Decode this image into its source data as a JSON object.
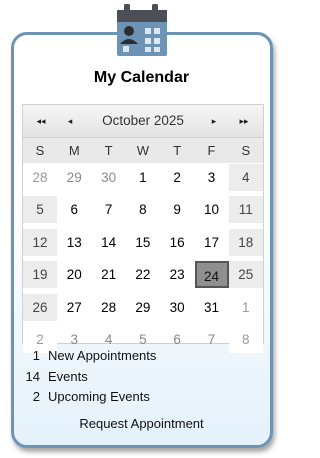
{
  "widget": {
    "title": "My Calendar",
    "request_label": "Request Appointment"
  },
  "calendar": {
    "month_label": "October 2025",
    "nav": {
      "prev_year": "◂◂",
      "prev_month": "◂",
      "next_month": "▸",
      "next_year": "▸▸"
    },
    "weekdays": [
      "S",
      "M",
      "T",
      "W",
      "T",
      "F",
      "S"
    ],
    "weeks": [
      [
        "28",
        "29",
        "30",
        "1",
        "2",
        "3",
        "4"
      ],
      [
        "5",
        "6",
        "7",
        "8",
        "9",
        "10",
        "11"
      ],
      [
        "12",
        "13",
        "14",
        "15",
        "16",
        "17",
        "18"
      ],
      [
        "19",
        "20",
        "21",
        "22",
        "23",
        "24",
        "25"
      ],
      [
        "26",
        "27",
        "28",
        "29",
        "30",
        "31",
        "1"
      ],
      [
        "2",
        "3",
        "4",
        "5",
        "6",
        "7",
        "8"
      ]
    ],
    "selected_day": "24"
  },
  "summary": [
    {
      "count": "1",
      "label": "New Appointments"
    },
    {
      "count": "14",
      "label": "Events"
    },
    {
      "count": "2",
      "label": "Upcoming Events"
    }
  ],
  "colors": {
    "frame_border": "#6d93b5",
    "today_fill": "#8f8f8f",
    "weekend_fill": "#ececec"
  }
}
